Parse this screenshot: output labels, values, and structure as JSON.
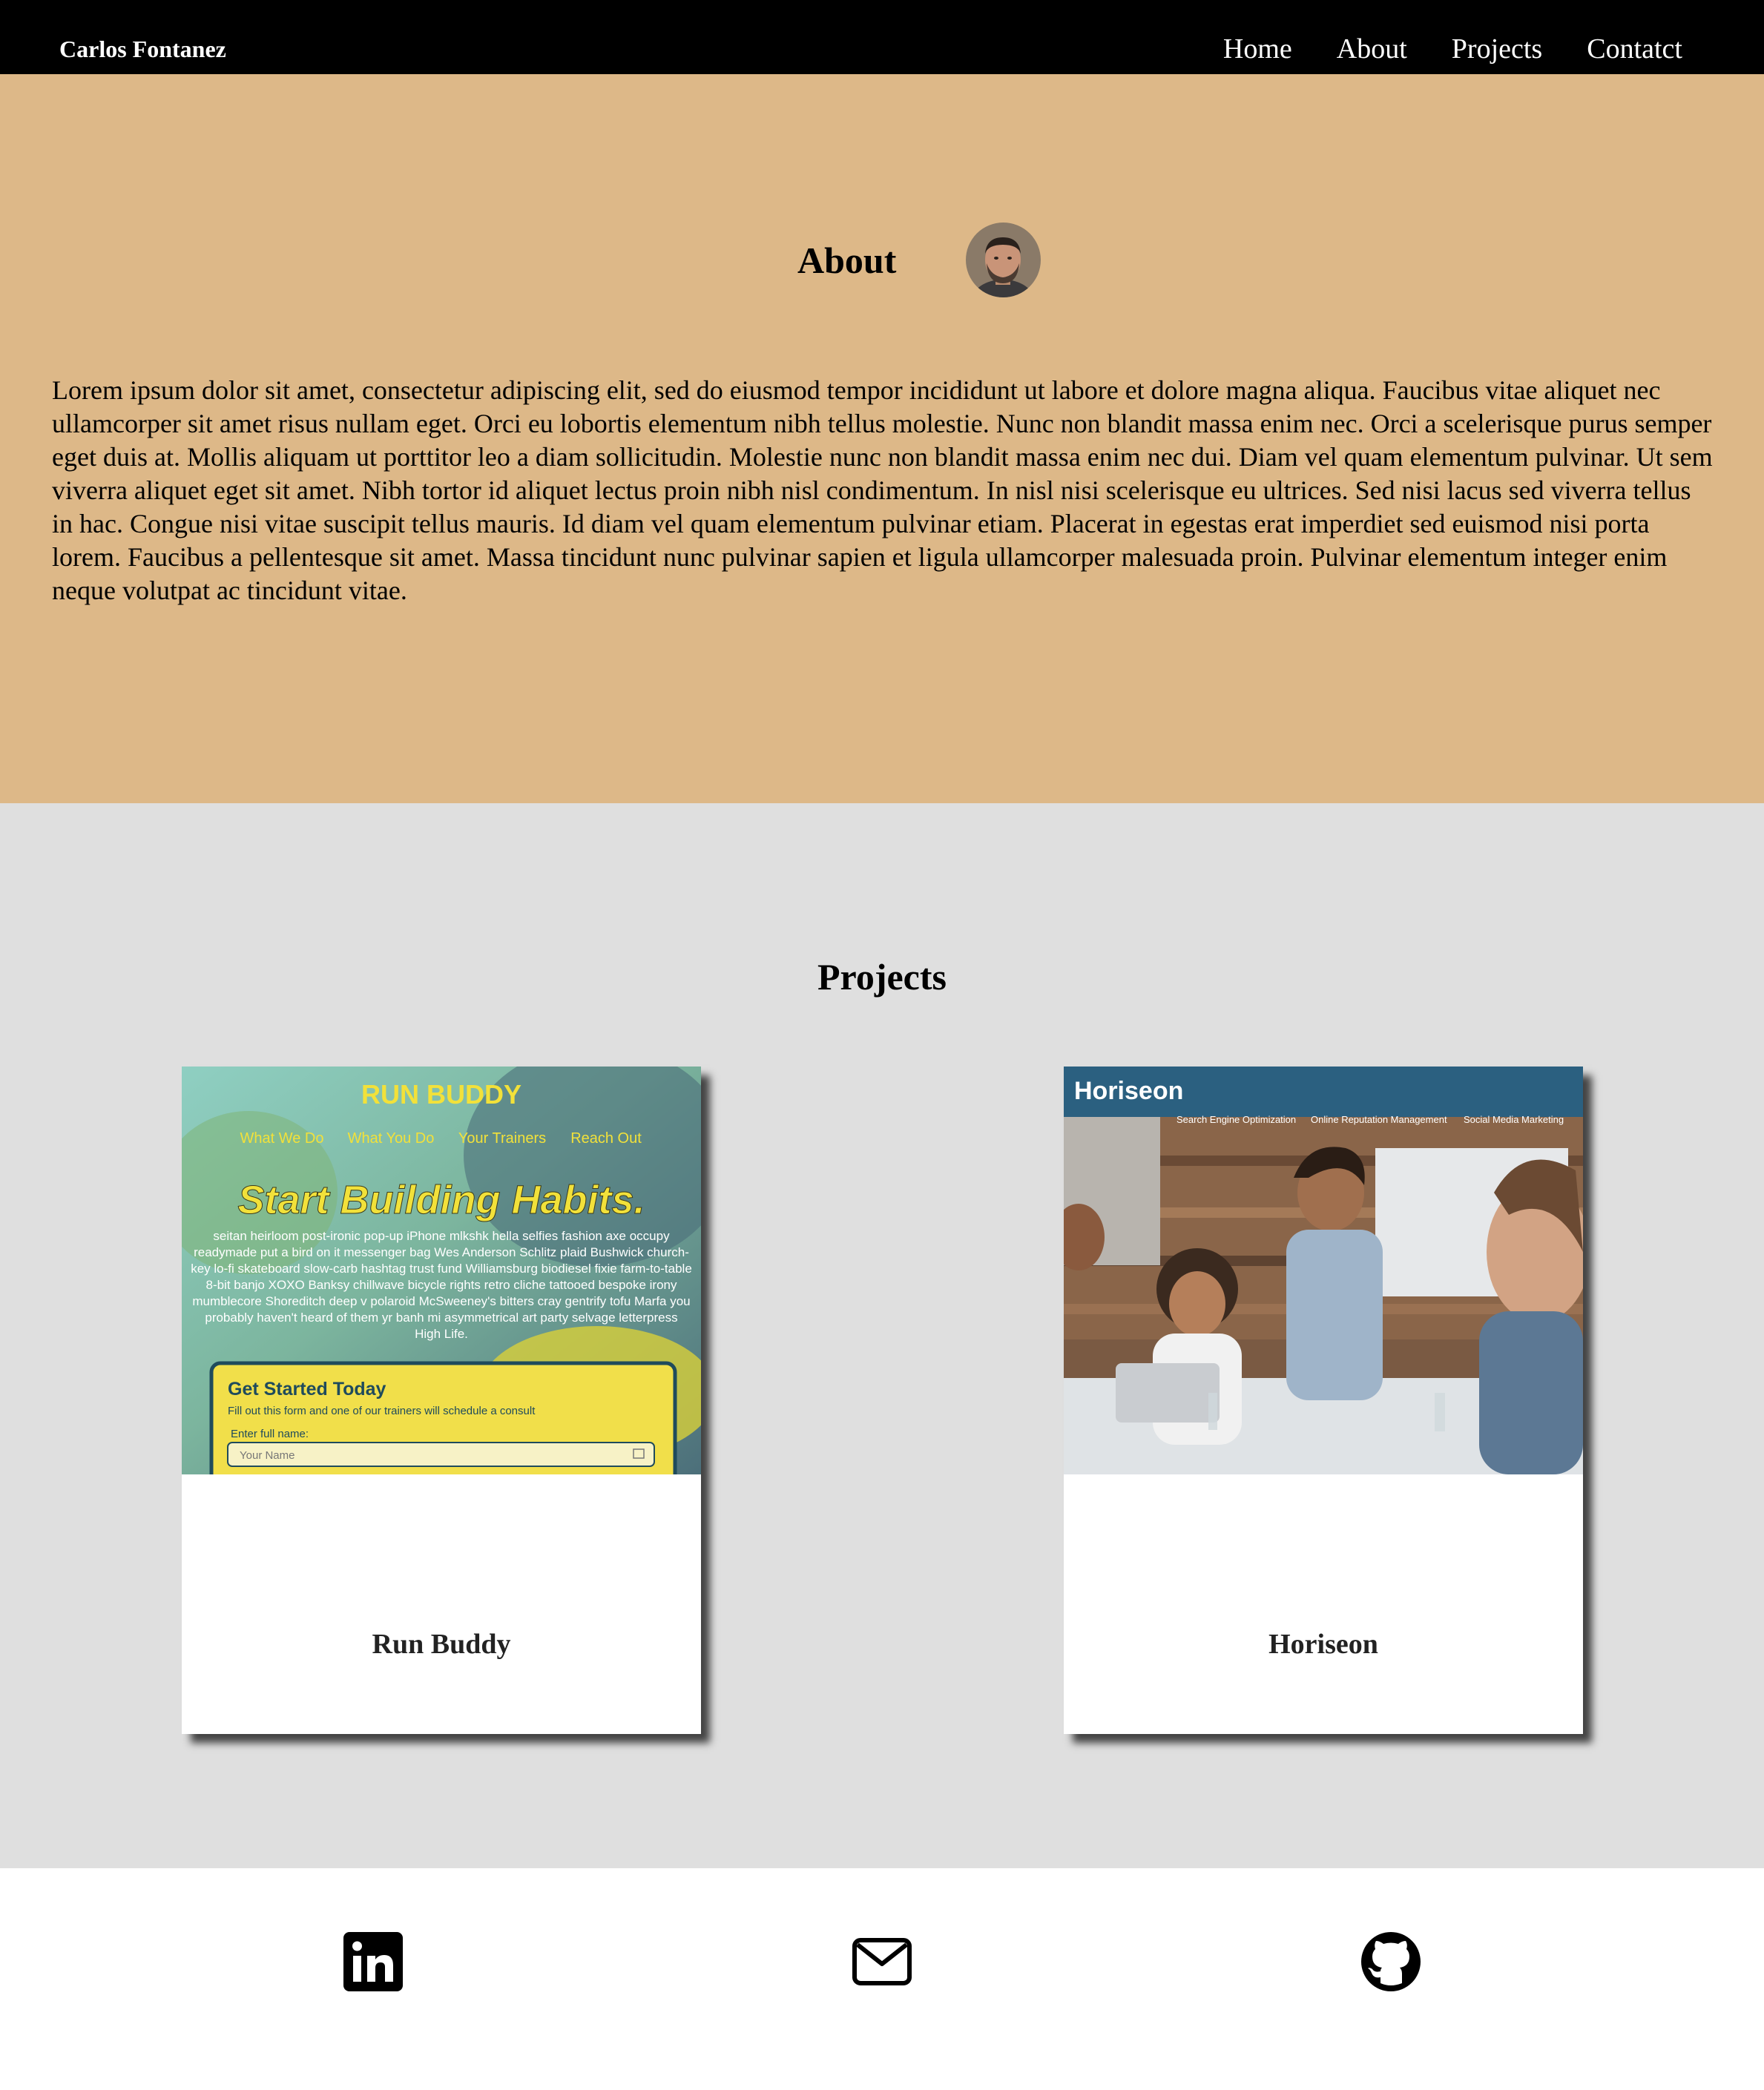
{
  "header": {
    "brand": "Carlos Fontanez",
    "nav": [
      "Home",
      "About",
      "Projects",
      "Contatct"
    ]
  },
  "about": {
    "title": "About",
    "body": "Lorem ipsum dolor sit amet, consectetur adipiscing elit, sed do eiusmod tempor incididunt ut labore et dolore magna aliqua. Faucibus vitae aliquet nec ullamcorper sit amet risus nullam eget. Orci eu lobortis elementum nibh tellus molestie. Nunc non blandit massa enim nec. Orci a scelerisque purus semper eget duis at. Mollis aliquam ut porttitor leo a diam sollicitudin. Molestie nunc non blandit massa enim nec dui. Diam vel quam elementum pulvinar. Ut sem viverra aliquet eget sit amet. Nibh tortor id aliquet lectus proin nibh nisl condimentum. In nisl nisi scelerisque eu ultrices. Sed nisi lacus sed viverra tellus in hac. Congue nisi vitae suscipit tellus mauris. Id diam vel quam elementum pulvinar etiam. Placerat in egestas erat imperdiet sed euismod nisi porta lorem. Faucibus a pellentesque sit amet. Massa tincidunt nunc pulvinar sapien et ligula ullamcorper malesuada proin. Pulvinar elementum integer enim neque volutpat ac tincidunt vitae."
  },
  "projects": {
    "title": "Projects",
    "items": [
      {
        "name": "Run Buddy",
        "screenshot": {
          "logo": "RUN BUDDY",
          "nav": [
            "What We Do",
            "What You Do",
            "Your Trainers",
            "Reach Out"
          ],
          "headline": "Start Building Habits.",
          "body": "seitan heirloom post-ironic pop-up iPhone mlkshk hella selfies fashion axe occupy readymade put a bird on it messenger bag Wes Anderson Schlitz plaid Bushwick church-key lo-fi skateboard slow-carb hashtag trust fund Williamsburg biodiesel fixie farm-to-table 8-bit banjo XOXO Banksy chillwave bicycle rights retro cliche tattooed bespoke irony mumblecore Shoreditch deep v polaroid McSweeney's bitters cray gentrify tofu Marfa you probably haven't heard of them yr banh mi asymmetrical art party selvage letterpress High Life.",
          "form_title": "Get Started Today",
          "form_sub": "Fill out this form and one of our trainers will schedule a consult",
          "field_label": "Enter full name:",
          "field_placeholder": "Your Name"
        }
      },
      {
        "name": "Horiseon",
        "screenshot": {
          "logo": "Horiseon",
          "nav": [
            "Search Engine Optimization",
            "Online Reputation Management",
            "Social Media Marketing"
          ]
        }
      }
    ]
  },
  "footer": {
    "icons": [
      "linkedin-icon",
      "mail-icon",
      "github-icon"
    ]
  },
  "colors": {
    "header_bg": "#000000",
    "about_bg": "#ddb888",
    "projects_bg": "#dfdfdf",
    "footer_bg": "#ffffff",
    "runbuddy_yellow": "#f2e13a",
    "horiseon_blue": "#2b6080"
  }
}
